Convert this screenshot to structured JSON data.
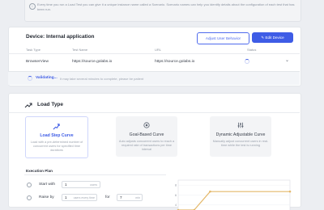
{
  "info": {
    "text": "Every time you run a Load Test you can give it a unique instance name called a Scenario. Scenario names can help you identify details about the configuration of each test that has been run."
  },
  "device": {
    "title_prefix": "Device:",
    "title_name": "Internal application",
    "adjust_button": "Adjust User Behavior",
    "edit_button": "Edit Device",
    "headers": [
      "Task Type",
      "Test Name",
      "URL",
      "Status"
    ],
    "row": {
      "task_type": "BrowserView",
      "test_name": "https://source.golabs.io",
      "url": "https://source.golabs.io"
    },
    "validating_label": "Validating...",
    "validating_note": "It may take several minutes to complete, please be patient"
  },
  "load_type": {
    "title": "Load Type",
    "options": [
      {
        "name": "Load Step Curve",
        "desc": "Load with a pre-determined number of concurrent users for specified time durations",
        "selected": true
      },
      {
        "name": "Goal-Based Curve",
        "desc": "Auto adjusts concurrent users to reach a required rate of transactions per time interval",
        "selected": false
      },
      {
        "name": "Dynamic Adjustable Curve",
        "desc": "Manually adjust concurrent users in real-time while the test is running",
        "selected": false
      }
    ]
  },
  "execution_plan": {
    "title": "Execution Plan",
    "start_label": "Start with",
    "start_value": "1",
    "start_unit": "users",
    "raise_label": "Raise by",
    "raise_value": "1",
    "raise_unit": "users every time",
    "for_label": "for",
    "for_value": "7",
    "for_unit": "min"
  },
  "colors": {
    "accent": "#3e5ce6",
    "curve": "#e4b86a"
  },
  "chart_data": {
    "type": "line",
    "title": "",
    "xlabel": "",
    "ylabel": "",
    "y_ticks": [
      "8",
      "6",
      "4"
    ],
    "ylim": [
      3,
      9
    ],
    "series": [
      {
        "x": [
          0,
          1,
          2,
          7
        ],
        "y": [
          3.0,
          3.0,
          6.7,
          6.7
        ]
      }
    ],
    "xlim": [
      0,
      7
    ],
    "grid": true
  }
}
